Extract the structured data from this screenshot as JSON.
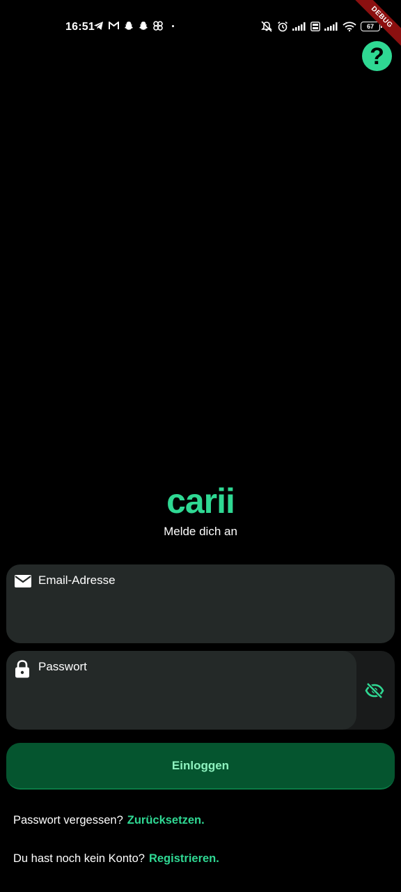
{
  "status_bar": {
    "time": "16:51",
    "battery_level": "67",
    "notification_icons": [
      "telegram-icon",
      "gmail-icon",
      "snapchat-icon",
      "snapchat-icon",
      "pinwheel-icon"
    ],
    "system_icons": [
      "notifications-off-icon",
      "alarm-icon",
      "signal-icon",
      "volte-icon",
      "signal-icon",
      "wifi-icon",
      "battery-icon"
    ]
  },
  "debug_banner": "DEBUG",
  "help_button": {
    "label": "?"
  },
  "app": {
    "logo_text": "carii",
    "subtitle": "Melde dich an"
  },
  "form": {
    "email_label": "Email-Adresse",
    "password_label": "Passwort",
    "login_button": "Einloggen"
  },
  "links": {
    "forgot_prefix": "Passwort vergessen?",
    "forgot_link": "Zurücksetzen.",
    "register_prefix": "Du hast noch kein Konto?",
    "register_link": "Registrieren."
  },
  "colors": {
    "accent": "#2fd893",
    "background": "#000000",
    "field": "#242928",
    "button": "#05552f",
    "button_text": "#8ef2bf"
  }
}
